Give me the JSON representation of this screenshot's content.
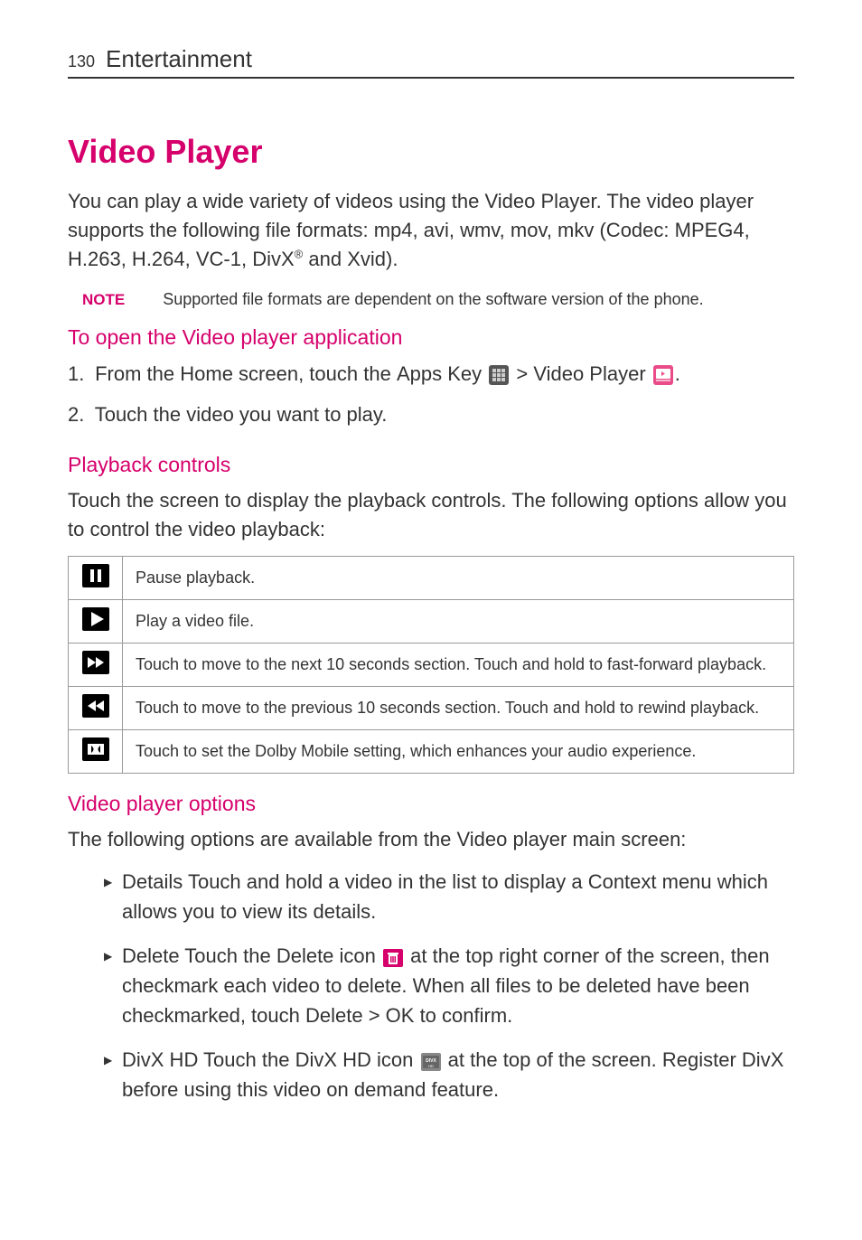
{
  "header": {
    "page_number": "130",
    "section": "Entertainment"
  },
  "title": "Video Player",
  "intro": {
    "text_before_sup": "You can play a wide variety of videos using the Video Player. The video player supports the following file formats: mp4, avi, wmv, mov, mkv (Codec: MPEG4, H.263, H.264, VC-1, DivX",
    "sup": "®",
    "text_after_sup": " and Xvid)."
  },
  "note": {
    "label": "NOTE",
    "text": "Supported file formats are dependent on the software version of the phone."
  },
  "open_section": {
    "heading": "To open the Video player application",
    "step1_prefix": "1.",
    "step1_part1": " From the Home screen, touch the ",
    "step1_apps_key": "Apps Key",
    "step1_gt": " > ",
    "step1_video_player": "Video Player",
    "step1_end": ".",
    "step2_prefix": "2.",
    "step2_text": " Touch the video you want to play."
  },
  "playback": {
    "heading": "Playback controls",
    "intro": "Touch the screen to display the playback controls. The following options allow you to control the video playback:",
    "rows": [
      {
        "icon": "pause",
        "desc": "Pause playback."
      },
      {
        "icon": "play",
        "desc": "Play a video file."
      },
      {
        "icon": "ffwd",
        "desc": "Touch to move to the next 10 seconds section. Touch and hold to fast-forward playback."
      },
      {
        "icon": "rwd",
        "desc": "Touch to move to the previous 10 seconds section. Touch and hold to rewind playback."
      },
      {
        "icon": "dolby",
        "desc": "Touch to set the Dolby Mobile setting, which enhances your audio experience."
      }
    ]
  },
  "options": {
    "heading": "Video player options",
    "intro": "The following options are available from the Video player main screen:",
    "details": {
      "label": "Details",
      "text": "  Touch and hold a video in the list to display a Context menu which allows you to view its details."
    },
    "delete": {
      "label": "Delete",
      "part1": "  Touch the ",
      "delete_word": "Delete",
      "part2": " icon ",
      "part3": " at the top right corner of the screen, then checkmark each video to delete. When all files to be deleted have been checkmarked, touch ",
      "delete_word2": "Delete",
      "gt": " > ",
      "ok": "OK",
      "part4": " to confirm."
    },
    "divx": {
      "label": "DivX HD",
      "part1": "  Touch the ",
      "divx_word": "DivX HD",
      "part2": " icon ",
      "part3": " at the top of the screen. Register DivX before using this video on demand feature."
    }
  }
}
